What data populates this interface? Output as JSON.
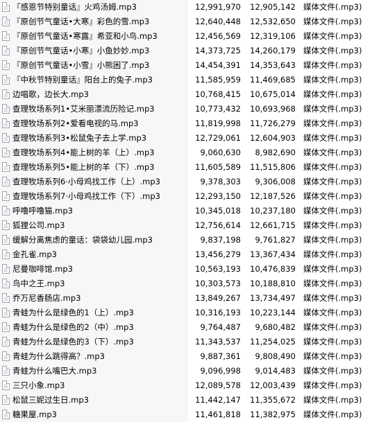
{
  "files": [
    {
      "name": "『感恩节特别童话』火鸡汤姆.mp3",
      "size": "12,991,970",
      "compressed": "12,905,142",
      "type": "媒体文件(.mp3)"
    },
    {
      "name": "『原创节气童话•大寒』彩色的雪.mp3",
      "size": "12,640,448",
      "compressed": "12,532,650",
      "type": "媒体文件(.mp3)"
    },
    {
      "name": "『原创节气童话•寒露』希亚和小鸟.mp3",
      "size": "12,456,569",
      "compressed": "12,319,106",
      "type": "媒体文件(.mp3)"
    },
    {
      "name": "『原创节气童话•小寒』小鱼妙妙.mp3",
      "size": "14,373,725",
      "compressed": "14,260,179",
      "type": "媒体文件(.mp3)"
    },
    {
      "name": "『原创节气童话•小雪』小熊困了.mp3",
      "size": "14,454,391",
      "compressed": "14,353,643",
      "type": "媒体文件(.mp3)"
    },
    {
      "name": "『中秋节特别童话』阳台上的兔子.mp3",
      "size": "11,585,959",
      "compressed": "11,469,685",
      "type": "媒体文件(.mp3)"
    },
    {
      "name": "边唱歌，边长大.mp3",
      "size": "10,768,415",
      "compressed": "10,675,014",
      "type": "媒体文件(.mp3)"
    },
    {
      "name": "查理牧场系列1•艾米丽漂流历险记.mp3",
      "size": "10,773,432",
      "compressed": "10,693,968",
      "type": "媒体文件(.mp3)"
    },
    {
      "name": "查理牧场系列2•爱看电视的马.mp3",
      "size": "11,819,998",
      "compressed": "11,726,279",
      "type": "媒体文件(.mp3)"
    },
    {
      "name": "查理牧场系列3•松鼠兔子去上学.mp3",
      "size": "12,729,061",
      "compressed": "12,604,903",
      "type": "媒体文件(.mp3)"
    },
    {
      "name": "查理牧场系列4•能上树的羊（上）.mp3",
      "size": "9,060,630",
      "compressed": "8,982,690",
      "type": "媒体文件(.mp3)"
    },
    {
      "name": "查理牧场系列5•能上树的羊（下）.mp3",
      "size": "11,605,589",
      "compressed": "11,515,806",
      "type": "媒体文件(.mp3)"
    },
    {
      "name": "查理牧场系列6·小母鸡找工作（上）.mp3",
      "size": "9,378,303",
      "compressed": "9,306,008",
      "type": "媒体文件(.mp3)"
    },
    {
      "name": "查理牧场系列7·小母鸡找工作（下）.mp3",
      "size": "12,293,150",
      "compressed": "12,187,526",
      "type": "媒体文件(.mp3)"
    },
    {
      "name": "呼噜呼噜猫.mp3",
      "size": "10,345,018",
      "compressed": "10,237,180",
      "type": "媒体文件(.mp3)"
    },
    {
      "name": "狐狸公司.mp3",
      "size": "12,756,614",
      "compressed": "12,661,715",
      "type": "媒体文件(.mp3)"
    },
    {
      "name": "缓解分离焦虑的童话：袋袋幼儿园.mp3",
      "size": "9,837,198",
      "compressed": "9,761,827",
      "type": "媒体文件(.mp3)"
    },
    {
      "name": "金孔雀.mp3",
      "size": "13,456,279",
      "compressed": "13,367,434",
      "type": "媒体文件(.mp3)"
    },
    {
      "name": "尼曼咖啡馆.mp3",
      "size": "10,563,193",
      "compressed": "10,476,839",
      "type": "媒体文件(.mp3)"
    },
    {
      "name": "鸟中之王.mp3",
      "size": "10,303,573",
      "compressed": "10,188,810",
      "type": "媒体文件(.mp3)"
    },
    {
      "name": "乔万尼香肠店.mp3",
      "size": "13,849,267",
      "compressed": "13,734,497",
      "type": "媒体文件(.mp3)"
    },
    {
      "name": "青蛙为什么是绿色的1（上）.mp3",
      "size": "10,316,193",
      "compressed": "10,223,144",
      "type": "媒体文件(.mp3)"
    },
    {
      "name": "青蛙为什么是绿色的2（中）.mp3",
      "size": "9,764,487",
      "compressed": "9,680,482",
      "type": "媒体文件(.mp3)"
    },
    {
      "name": "青蛙为什么是绿色的3（下）.mp3",
      "size": "11,343,537",
      "compressed": "11,254,025",
      "type": "媒体文件(.mp3)"
    },
    {
      "name": "青蛙为什么跳得高？.mp3",
      "size": "9,887,361",
      "compressed": "9,808,490",
      "type": "媒体文件(.mp3)"
    },
    {
      "name": "青蛙为什么嘴巴大.mp3",
      "size": "9,096,998",
      "compressed": "9,014,483",
      "type": "媒体文件(.mp3)"
    },
    {
      "name": "三只小象.mp3",
      "size": "12,089,578",
      "compressed": "12,003,439",
      "type": "媒体文件(.mp3)"
    },
    {
      "name": "松鼠三妮过生日.mp3",
      "size": "11,442,147",
      "compressed": "11,355,672",
      "type": "媒体文件(.mp3)"
    },
    {
      "name": "糖果屋.mp3",
      "size": "11,461,818",
      "compressed": "11,382,975",
      "type": "媒体文件(.mp3)"
    }
  ]
}
